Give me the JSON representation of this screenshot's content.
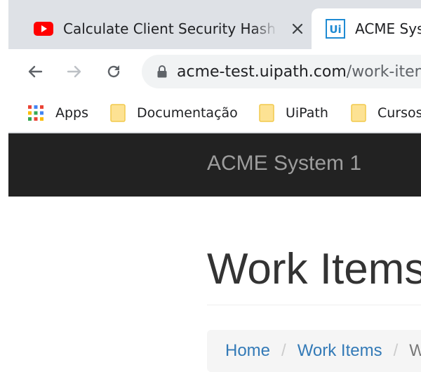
{
  "browser": {
    "tabs": [
      {
        "title": "Calculate Client Security Hash Pa",
        "icon": "youtube-icon",
        "active": false
      },
      {
        "title": "ACME Syst",
        "icon": "uipath-icon",
        "active": true
      }
    ],
    "url": {
      "host": "acme-test.uipath.com",
      "path": "/work-iten"
    },
    "bookmarks": [
      {
        "label": "Apps",
        "icon": "apps-grid-icon"
      },
      {
        "label": "Documentação",
        "icon": "folder-icon"
      },
      {
        "label": "UiPath",
        "icon": "folder-icon"
      },
      {
        "label": "Cursos",
        "icon": "folder-icon"
      }
    ]
  },
  "page": {
    "brand": "ACME System 1",
    "title": "Work Items",
    "breadcrumb": [
      {
        "label": "Home"
      },
      {
        "label": "Work Items"
      },
      {
        "label": "W"
      }
    ],
    "separator": "/"
  },
  "colors": {
    "navbar_bg": "#222222",
    "brand_text": "#9d9d9d",
    "link": "#337ab7",
    "tabstrip_bg": "#dee1e6"
  }
}
